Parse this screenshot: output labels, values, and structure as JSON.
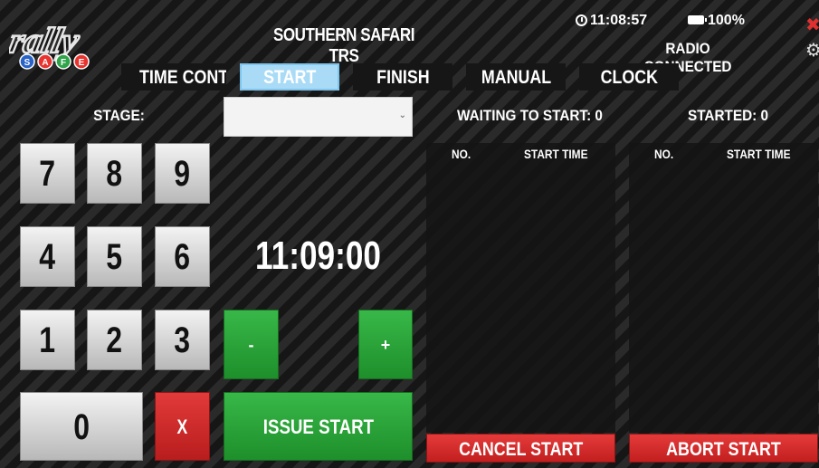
{
  "header": {
    "title": "SOUTHERN SAFARI TRS",
    "clock_time": "11:08:57",
    "battery": "100%",
    "radio_status": "RADIO CONNECTED",
    "logo_letters": [
      "S",
      "A",
      "F",
      "E"
    ],
    "logo_text": "rally"
  },
  "tabs": [
    {
      "label": "TIME CONTROL",
      "active": false
    },
    {
      "label": "START",
      "active": true
    },
    {
      "label": "FINISH",
      "active": false
    },
    {
      "label": "MANUAL",
      "active": false
    },
    {
      "label": "CLOCK",
      "active": false
    }
  ],
  "stage": {
    "label": "STAGE:",
    "selected": ""
  },
  "counters": {
    "waiting": "WAITING TO START: 0",
    "started": "STARTED: 0"
  },
  "keypad": {
    "k7": "7",
    "k8": "8",
    "k9": "9",
    "k4": "4",
    "k5": "5",
    "k6": "6",
    "k1": "1",
    "k2": "2",
    "k3": "3",
    "k0": "0",
    "clear": "X"
  },
  "time_display": "11:09:00",
  "controls": {
    "minus": "-",
    "plus": "+",
    "issue_start": "ISSUE START"
  },
  "waiting_list": {
    "col_no": "NO.",
    "col_time": "START TIME",
    "rows": []
  },
  "started_list": {
    "col_no": "NO.",
    "col_time": "START TIME",
    "rows": []
  },
  "actions": {
    "cancel_start": "CANCEL START",
    "abort_start": "ABORT START"
  },
  "colors": {
    "active_tab": "#a9dbf7",
    "green": "#2aa63a",
    "red": "#d22a2a",
    "logo_ball_colors": [
      "#2a63c8",
      "#e8332f",
      "#2fa44a",
      "#e8332f"
    ]
  }
}
